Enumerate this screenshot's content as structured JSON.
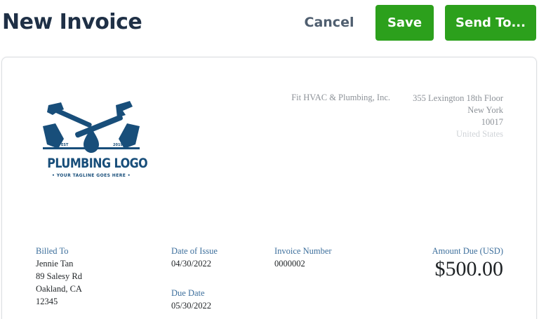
{
  "header": {
    "title": "New Invoice",
    "cancel_label": "Cancel",
    "save_label": "Save",
    "send_label": "Send To..."
  },
  "logo": {
    "text": "PLUMBING LOGO",
    "tagline": "• YOUR TAGLINE GOES HERE •",
    "est": "EST",
    "year": "2019",
    "color": "#184e7a"
  },
  "company": {
    "name": "Fit HVAC & Plumbing, Inc.",
    "address_line1": "355 Lexington 18th Floor",
    "city": "New York",
    "zip": "10017",
    "country": "United States"
  },
  "billed_to": {
    "label": "Billed To",
    "name": "Jennie Tan",
    "street": "89 Salesy Rd",
    "city": "Oakland, CA",
    "zip": "12345"
  },
  "dates": {
    "issue_label": "Date of Issue",
    "issue_value": "04/30/2022",
    "due_label": "Due Date",
    "due_value": "05/30/2022"
  },
  "invoice_number": {
    "label": "Invoice Number",
    "value": "0000002"
  },
  "amount_due": {
    "label": "Amount Due (USD)",
    "value": "$500.00"
  },
  "colors": {
    "brand_green": "#2ca01c",
    "title_navy": "#1f3046",
    "label_blue": "#3d6f9c"
  }
}
